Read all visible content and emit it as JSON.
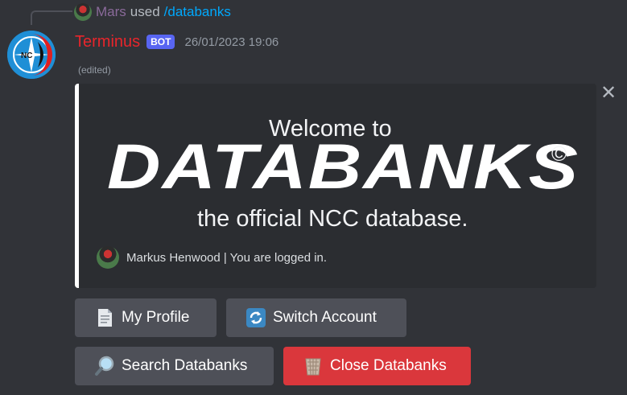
{
  "reply": {
    "user": "Mars",
    "used_text": "used",
    "command": "/databanks"
  },
  "message": {
    "author": "Terminus",
    "bot_tag": "BOT",
    "timestamp": "26/01/2023 19:06",
    "edited": "(edited)",
    "author_color": "#e8252b"
  },
  "embed": {
    "border_color": "#ffffff",
    "banner": {
      "line1": "Welcome to",
      "title": "DATABANKS",
      "copyright": "©",
      "line2": "the official NCC database."
    },
    "footer_text": "Markus Henwood | You are logged in."
  },
  "buttons": [
    {
      "label": "My Profile",
      "icon": "page-icon",
      "style": "secondary"
    },
    {
      "label": "Switch Account",
      "icon": "arrows-refresh-icon",
      "style": "secondary"
    },
    {
      "label": "Search Databanks",
      "icon": "magnifier-icon",
      "style": "secondary"
    },
    {
      "label": "Close Databanks",
      "icon": "wastebasket-icon",
      "style": "danger"
    }
  ],
  "colors": {
    "background": "#313338",
    "embed_bg": "#2b2d31",
    "secondary_button": "#4e5058",
    "danger_button": "#da373c",
    "bot_tag": "#5865f2",
    "command": "#00a8fc"
  }
}
